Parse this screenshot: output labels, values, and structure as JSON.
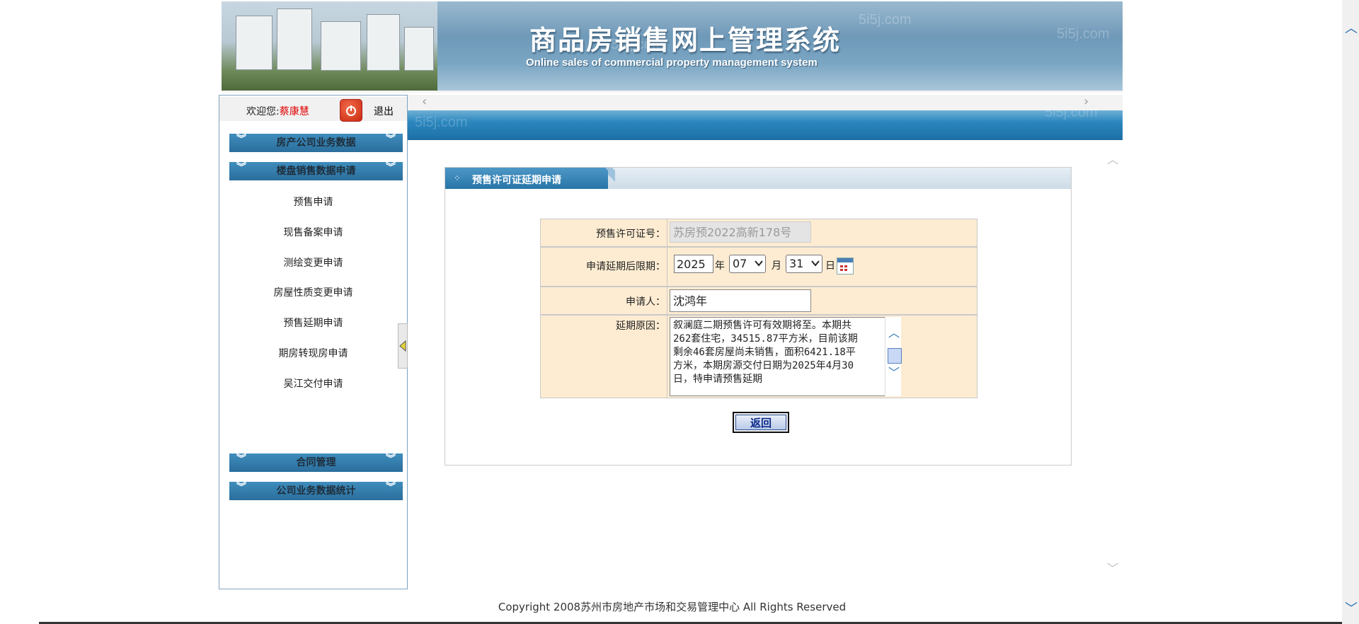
{
  "header": {
    "title": "商品房销售网上管理系统",
    "subtitle": "Online sales of commercial property management system",
    "watermark": "5i5j.com"
  },
  "sidebar": {
    "welcome_label": "欢迎您:",
    "user_name": "蔡康慧",
    "logout_label": "退出",
    "sections": [
      {
        "label": "房产公司业务数据"
      },
      {
        "label": "楼盘销售数据申请"
      },
      {
        "label": "合同管理"
      },
      {
        "label": "公司业务数据统计"
      }
    ],
    "items": [
      {
        "label": "预售申请"
      },
      {
        "label": "现售备案申请"
      },
      {
        "label": "测绘变更申请"
      },
      {
        "label": "房屋性质变更申请"
      },
      {
        "label": "预售延期申请"
      },
      {
        "label": "期房转现房申请"
      },
      {
        "label": "吴江交付申请"
      }
    ]
  },
  "panel": {
    "title": "预售许可证延期申请",
    "permit_label": "预售许可证号：",
    "permit_value": "苏房预2022高新178号",
    "deadline_label": "申请延期后限期：",
    "year": "2025",
    "year_unit": "年",
    "month": "07",
    "month_unit": "月",
    "day": "31",
    "day_unit": "日",
    "applicant_label": "申请人：",
    "applicant_value": "沈鸿年",
    "reason_label": "延期原因：",
    "reason_value": "叙澜庭二期预售许可有效期将至。本期共262套住宅，34515.87平方米，目前该期剩余46套房屋尚未销售，面积6421.18平方米，本期房源交付日期为2025年4月30日，特申请预售延期",
    "back_button": "返回"
  },
  "footer": {
    "copyright": "Copyright 2008苏州市房地产市场和交易管理中心  All Rights Reserved"
  }
}
